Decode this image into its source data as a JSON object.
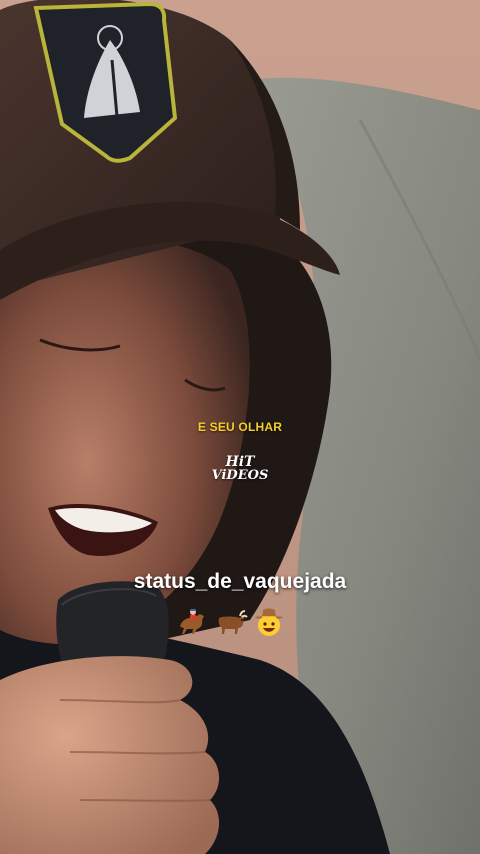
{
  "caption": "E SEU OLHAR",
  "watermark": {
    "line1": "HiT",
    "line2": "ViDEOS"
  },
  "username": "status_de_vaquejada",
  "emojis": [
    "horse-racing-icon",
    "ox-icon",
    "cowboy-face-icon"
  ],
  "colors": {
    "caption": "#f4cf2a",
    "cap": "#3b2a24",
    "patch_border": "#b9b43a",
    "couch": "#8e9087",
    "wall": "#c79a86"
  }
}
